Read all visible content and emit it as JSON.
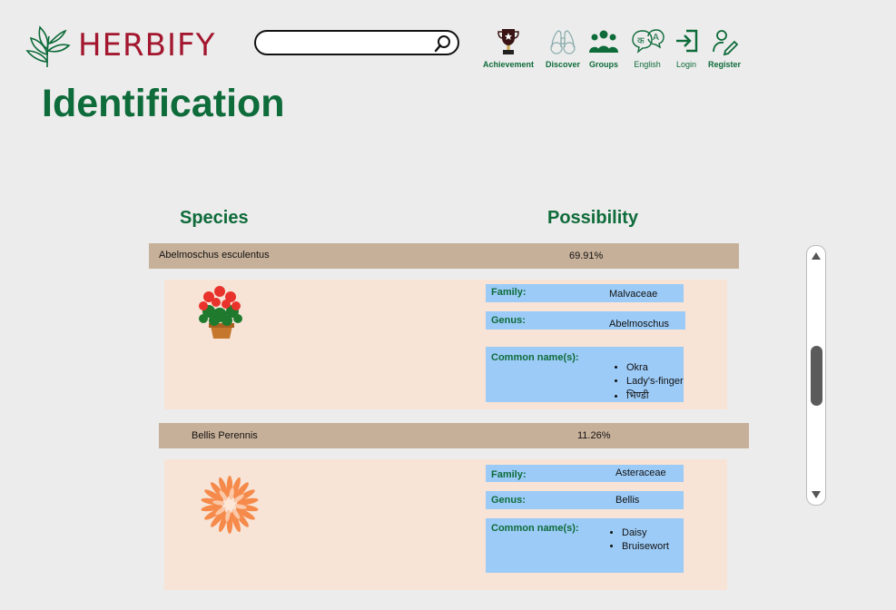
{
  "brand": {
    "name": "HERBIFY"
  },
  "search": {
    "placeholder": ""
  },
  "nav": [
    {
      "label": "Achievement",
      "icon": "trophy-icon"
    },
    {
      "label": "Discover",
      "icon": "binoculars-icon"
    },
    {
      "label": "Groups",
      "icon": "groups-icon"
    },
    {
      "label": "English",
      "icon": "language-icon"
    },
    {
      "label": "Login",
      "icon": "login-icon"
    },
    {
      "label": "Register",
      "icon": "register-icon"
    }
  ],
  "page": {
    "title": "Identification"
  },
  "columns": {
    "species": "Species",
    "possibility": "Possibility"
  },
  "results": [
    {
      "species": "Abelmoschus esculentus",
      "possibility": "69.91%",
      "family_label": "Family:",
      "family": "Malvaceae",
      "genus_label": "Genus:",
      "genus": "Abelmoschus",
      "common_label": "Common name(s):",
      "common_names": [
        "Okra",
        "Lady's-finger",
        "भिण्डी"
      ],
      "image": "geranium-pot-icon"
    },
    {
      "species": "Bellis Perennis",
      "possibility": "11.26%",
      "family_label": "Family:",
      "family": "Asteraceae",
      "genus_label": "Genus:",
      "genus": "Bellis",
      "common_label": "Common name(s):",
      "common_names": [
        "Daisy",
        "Bruisewort"
      ],
      "image": "daisy-icon"
    }
  ],
  "colors": {
    "brand": "#a3172f",
    "accent_green": "#0e6b3a",
    "result_bar": "#c7b099",
    "card_bg": "#f7e4d7",
    "info_bg": "#9ccbf7"
  }
}
